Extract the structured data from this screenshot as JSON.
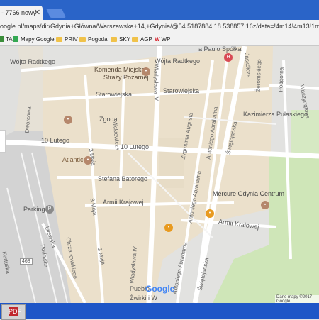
{
  "browser": {
    "tab_title": "- 7766 nowy",
    "tab_close": "✕",
    "url": "oogle.pl/maps/dir/Gdynia+Główna/Warszawska+14,+Gdynia/@54.5187884,18.538857,16z/data=!4m14!4m13!1m5!1m1!1s0x"
  },
  "bookmarks": [
    {
      "label": "TA",
      "icon": "app-icon"
    },
    {
      "label": "Mapy Google",
      "icon": "maps-icon"
    },
    {
      "label": "PRIV",
      "icon": "folder-icon"
    },
    {
      "label": "Pogoda",
      "icon": "folder-icon"
    },
    {
      "label": "SKY",
      "icon": "folder-icon"
    },
    {
      "label": "AGP",
      "icon": "folder-icon"
    },
    {
      "label": "WP",
      "icon": "wp-icon"
    }
  ],
  "map": {
    "streets": {
      "wojta_radtkego_1": "Wójta Radtkego",
      "wojta_radtkego_2": "Wójta Radtkego",
      "komenda_1": "Komenda Miejska",
      "komenda_2": "Straży Pożarnej",
      "starowiejska_1": "Starowiejska",
      "starowiejska_2": "Starowiejska",
      "zgoda": "Zgoda",
      "dworcowa": "Dworcowa",
      "lutego_1": "10 Lutego",
      "lutego_2": "10 Lutego",
      "atlantic": "Atlantic",
      "stefana_batorego": "Stefana Batorego",
      "armii_krajowej_1": "Armii Krajowej",
      "armii_krajowej_2": "Armii Krajowej",
      "parking": "Parking",
      "trzeciego_maja_1": "3 Maja",
      "trzeciego_maja_2": "3 Maja",
      "trzeciego_maja_3": "3 Maja",
      "mickiewicza": "Mickiewicza",
      "wladyslawa_iv_1": "Władysława IV",
      "wladyslawa_iv_2": "Władysława IV",
      "zygmunta_augusta": "Zygmunta Augusta",
      "antoniego_abrahama_1": "Antoniego Abrahama",
      "antoniego_abrahama_2": "Antoniego Abrahama",
      "antoniego_abrahama_3": "Antoniego Abrahama",
      "swietojanska_1": "Świętojańska",
      "swietojanska_2": "Świętojańska",
      "kazimierza_pulaskiego": "Kazimierza Pułaskiego",
      "mercure": "Mercure Gdynia Centrum",
      "paulo_spolka": "a Paulo Spółka",
      "road_468": "468",
      "zwirki": "Żwirki i W",
      "zeromskiego": "Żeromskiego",
      "podgorna": "Podgórna",
      "waszyngtona": "Waszyngtona",
      "jaskolcza": "Jaskółcza",
      "pobieg": "Pueblo",
      "litewska": "Litewska",
      "podolska": "Podolska",
      "chrzanowskiego": "Chrzanowskiego",
      "kartuska": "Kartuska"
    },
    "google_logo": "Google",
    "map_data": "Dane mapy ©2017 Google"
  },
  "taskbar": {
    "app_icon_label": "PDF"
  }
}
